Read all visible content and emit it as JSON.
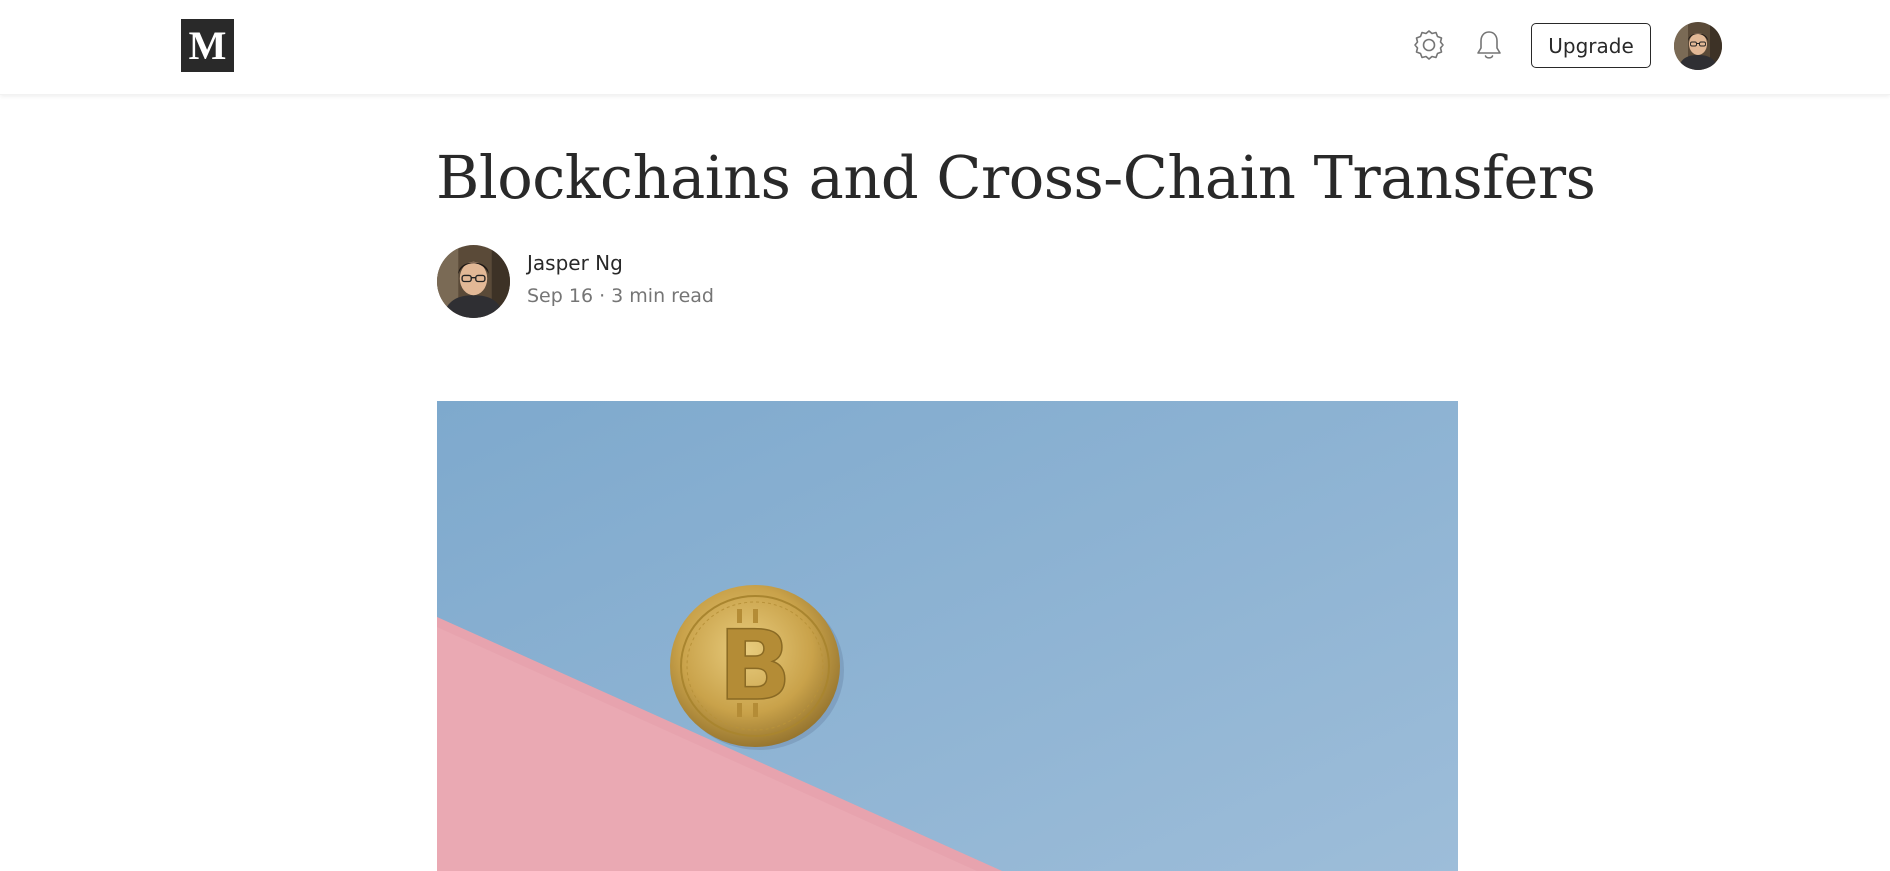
{
  "header": {
    "logo_letter": "M",
    "upgrade_label": "Upgrade",
    "icons": [
      "gear-icon",
      "bell-icon"
    ]
  },
  "article": {
    "title": "Blockchains and Cross-Chain Transfers",
    "author": "Jasper Ng",
    "date": "Sep 16",
    "separator": "·",
    "read_time": "3 min read"
  },
  "colors": {
    "text": "#292929",
    "muted": "#757575",
    "hero_blue": "#8db3d3",
    "hero_pink": "#eaa9b3",
    "coin_gold": "#c9a24a"
  }
}
